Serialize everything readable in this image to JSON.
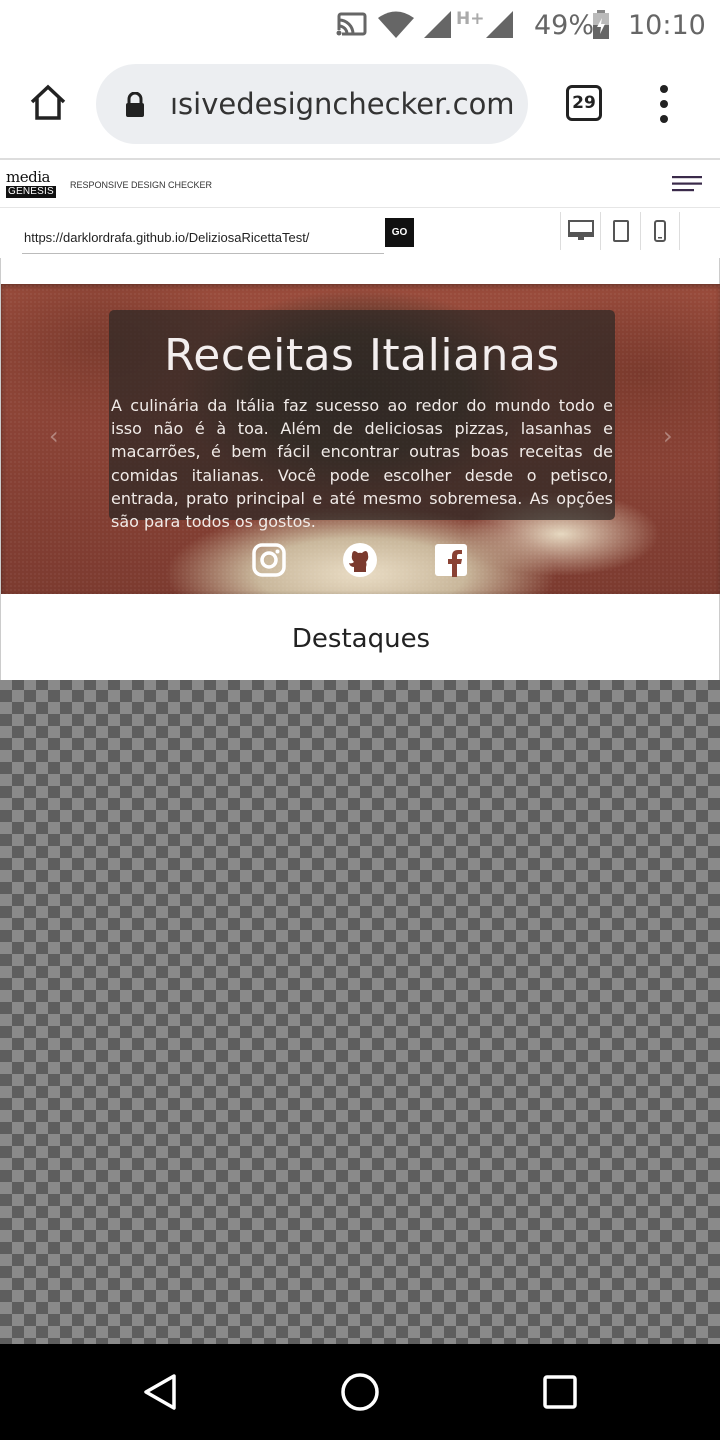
{
  "status_bar": {
    "battery": "49%",
    "time": "10:10",
    "network": "H+"
  },
  "browser": {
    "url_text": "ısivedesigncheck‌er.com",
    "tab_count": "29"
  },
  "checker": {
    "logo_line1": "media",
    "logo_line2": "GENESIS",
    "title": "RESPONSIVE DESIGN CHECKER",
    "url_value": "https://darklordrafa.github.io/DeliziosaRicettaTest/",
    "go_label": "GO"
  },
  "site": {
    "hero_title": "Receitas Italianas",
    "hero_text": "A culinária da Itália faz sucesso ao redor do mundo todo e isso não é à toa. Além de deliciosas pizzas, lasanhas e macarrões, é bem fácil encontrar outras boas receitas de comidas italianas. Você pode escolher desde o petisco, entrada, prato principal e até mesmo sobremesa. As opções são para todos os gostos.",
    "arrow_prev": "‹",
    "arrow_next": "›",
    "section_title": "Destaques",
    "social": [
      "instagram-icon",
      "github-icon",
      "facebook-icon"
    ]
  },
  "colors": {
    "hero_card": "#2d2826",
    "nav_bar": "#000000",
    "go_button": "#111111"
  }
}
